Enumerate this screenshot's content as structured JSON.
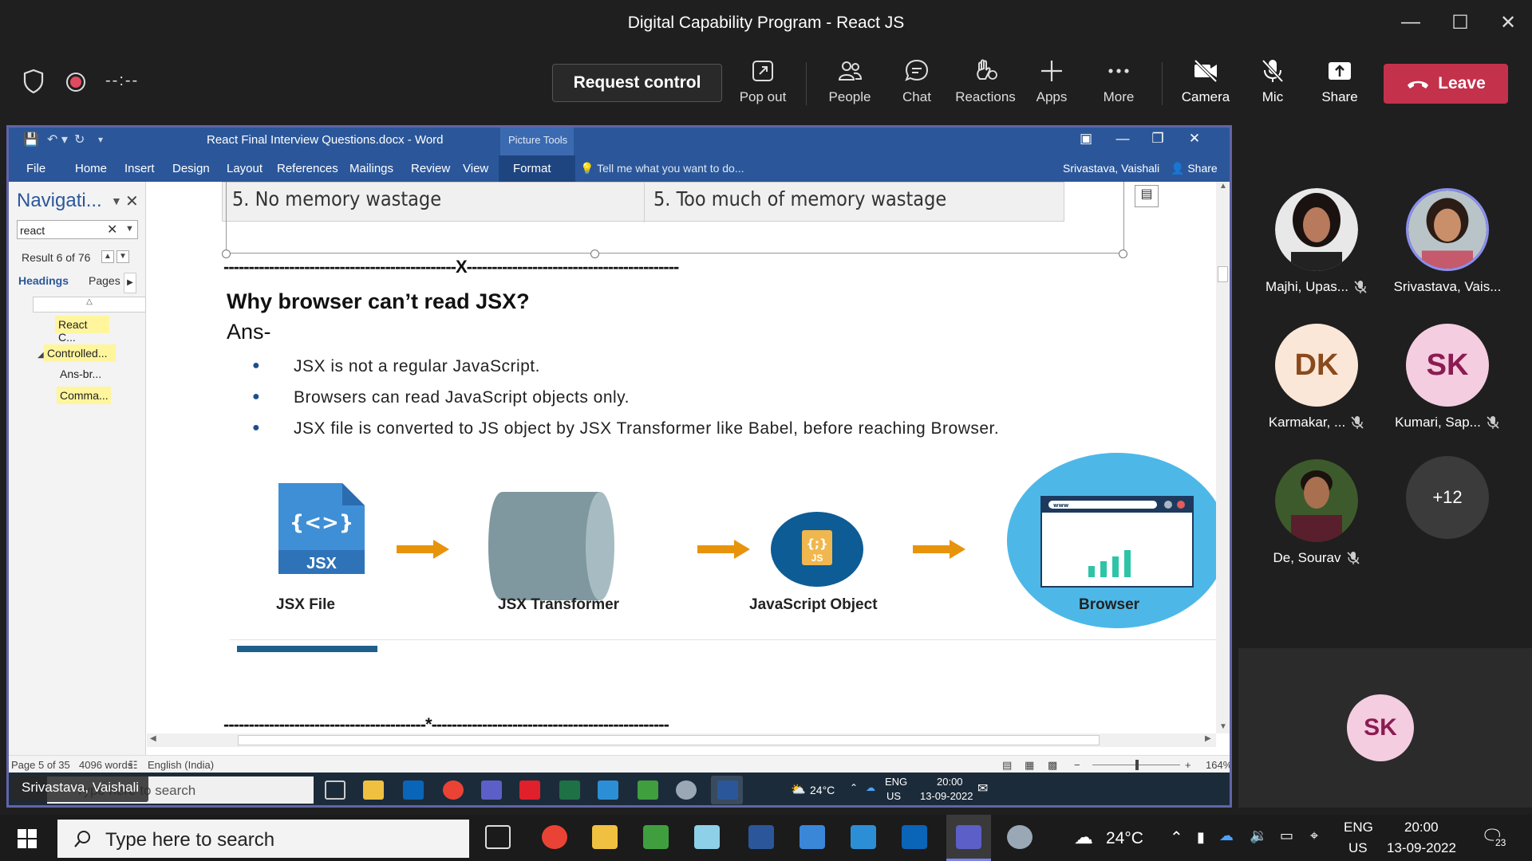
{
  "window": {
    "title": "Digital Capability Program - React JS"
  },
  "toolbar": {
    "timer": "--:--",
    "request_control": "Request control",
    "pop_out": "Pop out",
    "people": "People",
    "chat": "Chat",
    "reactions": "Reactions",
    "apps": "Apps",
    "more": "More",
    "camera": "Camera",
    "mic": "Mic",
    "share": "Share",
    "leave": "Leave"
  },
  "word": {
    "doc_title": "React Final Interview Questions.docx - Word",
    "picture_tools": "Picture Tools",
    "ribbon": {
      "file": "File",
      "home": "Home",
      "insert": "Insert",
      "design": "Design",
      "layout": "Layout",
      "references": "References",
      "mailings": "Mailings",
      "review": "Review",
      "view": "View",
      "format": "Format",
      "tell_me": "Tell me what you want to do...",
      "user": "Srivastava, Vaishali",
      "share": "Share"
    },
    "nav": {
      "title": "Navigati...",
      "search_value": "react",
      "result": "Result 6 of 76",
      "tab_headings": "Headings",
      "tab_pages": "Pages",
      "headings": [
        "React C...",
        "Controlled...",
        "Ans-br...",
        "Comma..."
      ]
    },
    "doc": {
      "table_left": "5. No memory wastage",
      "table_right": "5. Too much of memory wastage",
      "divider_top": "----------------------------------------------X------------------------------------------",
      "question": "Why browser can’t read JSX?",
      "answer_label": "Ans-",
      "bullets": [
        "JSX is not a regular JavaScript.",
        "Browsers can read JavaScript objects only.",
        "JSX file is converted to JS object by JSX Transformer like Babel, before reaching Browser."
      ],
      "diagram": {
        "jsx_icon_top": "{<>}",
        "jsx_icon_bottom": "JSX",
        "js_icon_top": "{;}",
        "js_icon_bottom": "JS",
        "url_bar": "www",
        "labels": [
          "JSX File",
          "JSX Transformer",
          "JavaScript Object",
          "Browser"
        ]
      },
      "divider_bottom": "----------------------------------------*-----------------------------------------------"
    },
    "status": {
      "page": "Page 5 of 35",
      "words": "4096 words",
      "language": "English (India)",
      "zoom": "164%"
    },
    "inner_taskbar": {
      "search": "Type here to search",
      "temp": "24°C",
      "lang1": "ENG",
      "lang2": "US",
      "time": "20:00",
      "date": "13-09-2022"
    },
    "presenter": "Srivastava, Vaishali"
  },
  "participants": [
    {
      "name": "Majhi, Upas...",
      "initials": "",
      "muted": true
    },
    {
      "name": "Srivastava, Vais...",
      "initials": "",
      "muted": false
    },
    {
      "name": "Karmakar, ...",
      "initials": "DK",
      "muted": true
    },
    {
      "name": "Kumari, Sap...",
      "initials": "SK",
      "muted": true
    },
    {
      "name": "De, Sourav",
      "initials": "",
      "muted": true
    },
    {
      "name": "",
      "initials": "+12",
      "muted": false
    }
  ],
  "stage_tile": {
    "initials": "SK"
  },
  "taskbar": {
    "search": "Type here to search",
    "temp": "24°C",
    "lang1": "ENG",
    "lang2": "US",
    "time": "20:00",
    "date": "13-09-2022",
    "notifications": "23"
  },
  "colors": {
    "teams_bg": "#1f1f1f",
    "leave": "#c4314b",
    "word_blue": "#2b579a",
    "arrow": "#e8930c",
    "browser_circle": "#4db8e8"
  }
}
